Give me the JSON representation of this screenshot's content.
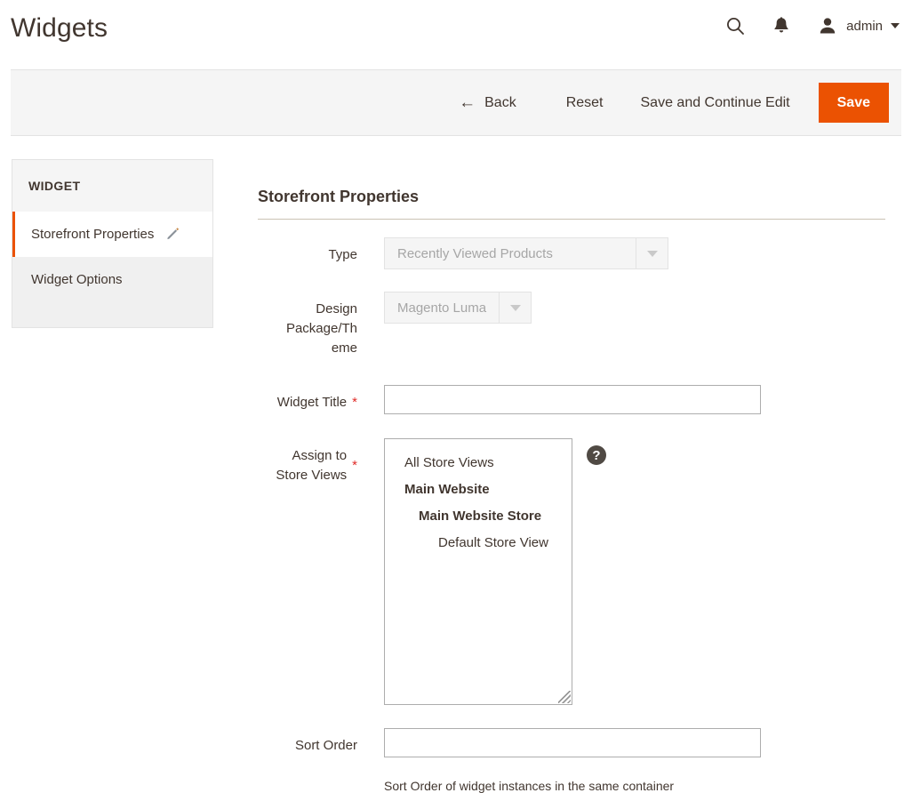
{
  "header": {
    "title": "Widgets",
    "search_icon": "search-icon",
    "notifications_icon": "bell-icon",
    "user_icon": "user-avatar-icon",
    "admin_label": "admin",
    "caret_icon": "chevron-down-icon"
  },
  "toolbar": {
    "back_label": "Back",
    "back_icon": "arrow-left-icon",
    "reset_label": "Reset",
    "save_continue_label": "Save and Continue Edit",
    "save_label": "Save",
    "save_button_color": "#eb5202"
  },
  "sidebar": {
    "title": "WIDGET",
    "items": [
      {
        "label": "Storefront Properties",
        "active": true,
        "icon": "pencil-icon"
      },
      {
        "label": "Widget Options",
        "active": false,
        "icon": ""
      }
    ],
    "active_marker_color": "#eb5202"
  },
  "form": {
    "legend": "Storefront Properties",
    "fields": {
      "type": {
        "label": "Type",
        "value": "Recently Viewed Products",
        "disabled": true,
        "arrow_icon": "chevron-down-icon"
      },
      "theme": {
        "label": "Design Package/Theme",
        "label_line1": "Design",
        "label_line2": "Package/Th",
        "label_line3": "eme",
        "value": "Magento Luma",
        "disabled": true,
        "arrow_icon": "chevron-down-icon"
      },
      "widget_title": {
        "label": "Widget Title",
        "required": true,
        "required_marker": "*",
        "value": "",
        "placeholder": ""
      },
      "store_views": {
        "label": "Assign to Store Views",
        "label_line1": "Assign to",
        "label_line2": "Store Views",
        "required": true,
        "required_marker": "*",
        "help_icon": "question-mark-icon",
        "options": [
          {
            "label": "All Store Views",
            "level": 0
          },
          {
            "label": "Main Website",
            "level": 1
          },
          {
            "label": "Main Website Store",
            "level": 2
          },
          {
            "label": "Default Store View",
            "level": 3
          }
        ]
      },
      "sort_order": {
        "label": "Sort Order",
        "value": "",
        "placeholder": "",
        "note": "Sort Order of widget instances in the same container"
      }
    }
  }
}
